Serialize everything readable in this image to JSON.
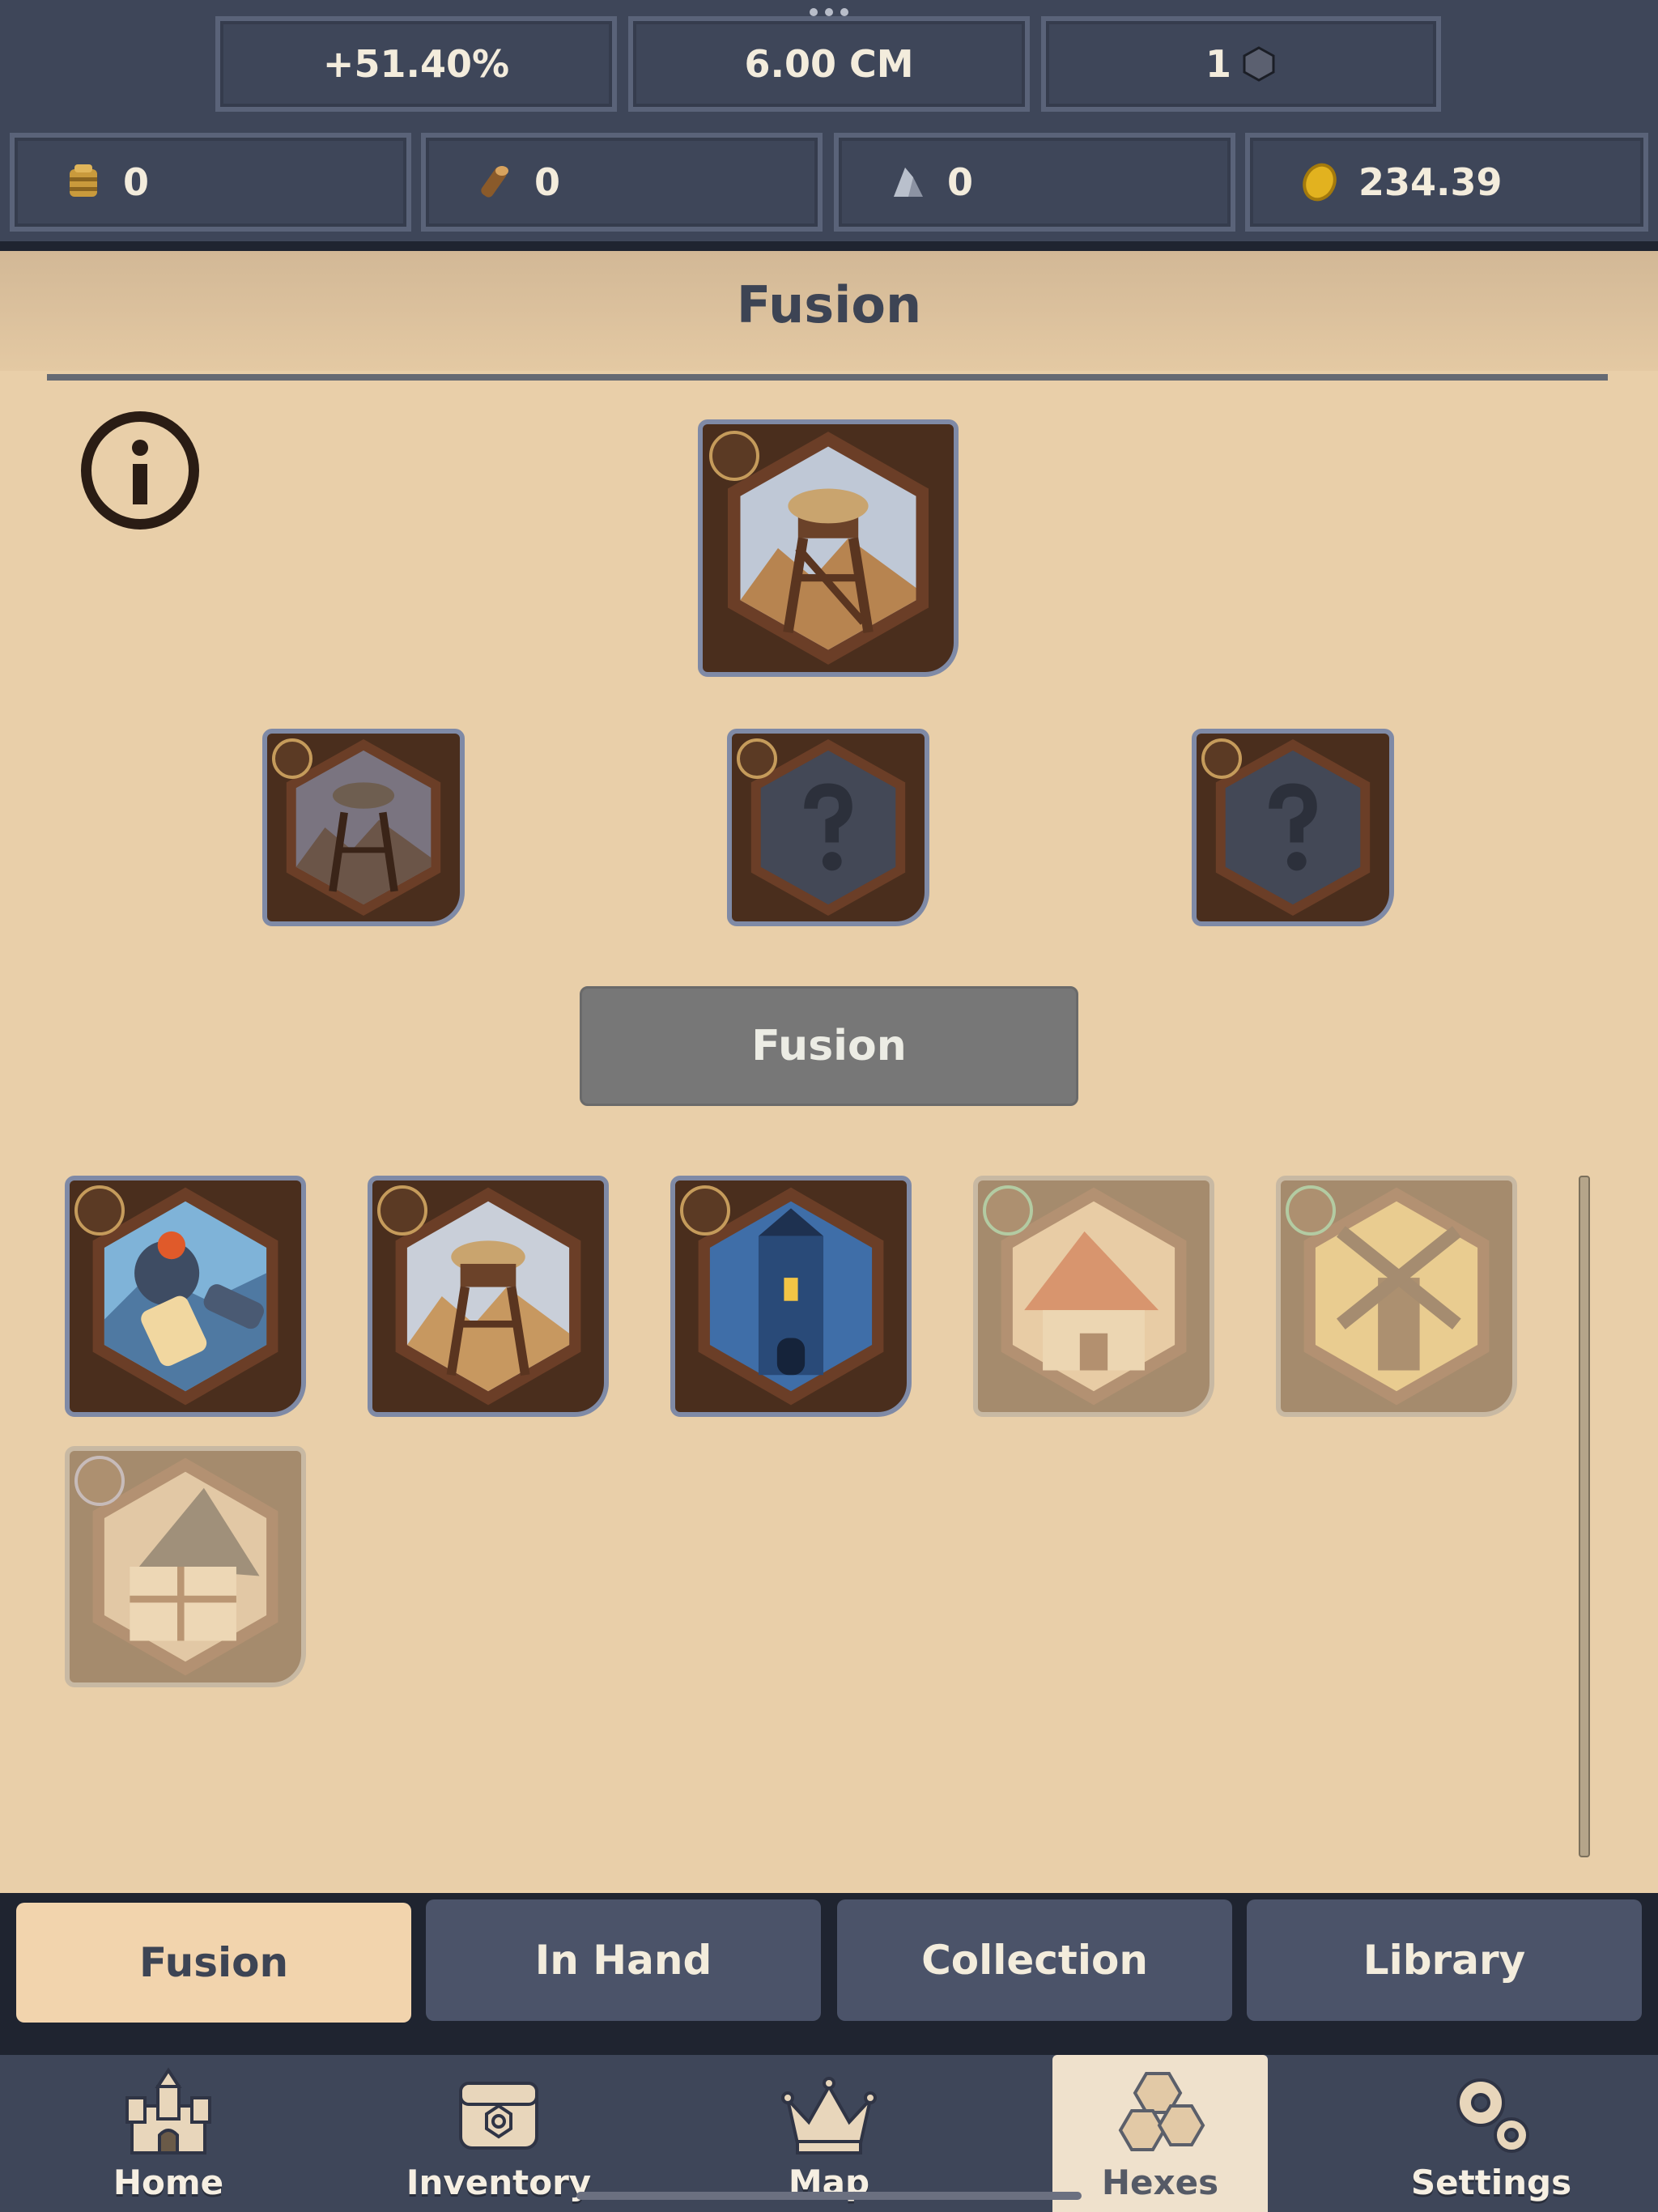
{
  "stats": {
    "bonus": "+51.40%",
    "cm": "6.00 CM",
    "hex_count": "1",
    "hay": "0",
    "wood": "0",
    "stone": "0",
    "gold": "234.39"
  },
  "page": {
    "title": "Fusion"
  },
  "fusion": {
    "button_label": "Fusion",
    "result_card": {
      "icon": "watchtower",
      "badge": "horn-icon"
    },
    "input_slots": [
      {
        "icon": "watchtower",
        "state": "selected",
        "badge": "horn-icon"
      },
      {
        "icon": "question-mark",
        "state": "empty",
        "badge": "horn-icon"
      },
      {
        "icon": "question-mark",
        "state": "empty",
        "badge": "horn-icon"
      }
    ]
  },
  "cards": [
    {
      "icon": "fist-scroll",
      "badge": "horn-icon",
      "enabled": true
    },
    {
      "icon": "watchtower",
      "badge": "horn-icon",
      "enabled": true
    },
    {
      "icon": "blue-tower",
      "badge": "horn-icon",
      "enabled": true
    },
    {
      "icon": "red-roof-house",
      "badge": "leaf-icon",
      "enabled": false
    },
    {
      "icon": "windmill",
      "badge": "leaf-icon",
      "enabled": false
    },
    {
      "icon": "timber-house",
      "badge": "star-icon",
      "enabled": false
    }
  ],
  "subtabs": [
    {
      "label": "Fusion",
      "active": true
    },
    {
      "label": "In Hand",
      "active": false
    },
    {
      "label": "Collection",
      "active": false
    },
    {
      "label": "Library",
      "active": false
    }
  ],
  "nav": [
    {
      "label": "Home",
      "icon": "castle-icon",
      "active": false
    },
    {
      "label": "Inventory",
      "icon": "bag-icon",
      "active": false
    },
    {
      "label": "Map",
      "icon": "crown-icon",
      "active": false
    },
    {
      "label": "Hexes",
      "icon": "hexes-icon",
      "active": true
    },
    {
      "label": "Settings",
      "icon": "gears-icon",
      "active": false
    }
  ],
  "colors": {
    "panel": "#3e4659",
    "background": "#e9cfa9",
    "active_tab": "#f2d4ad",
    "button_disabled": "#777777"
  }
}
